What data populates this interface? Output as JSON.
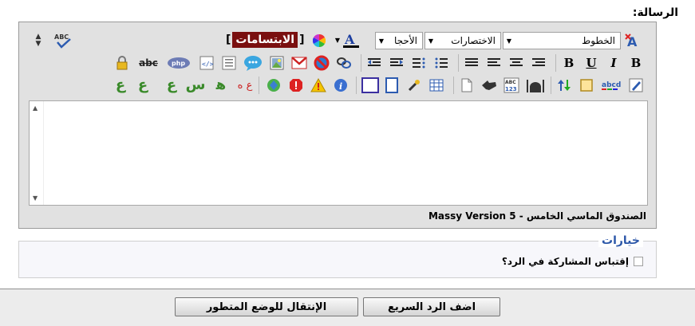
{
  "form": {
    "message_label": "الرسالة:"
  },
  "editor": {
    "font_select": "الخطوط",
    "shortcuts_select": "الاختصارات",
    "size_select": "الأحجا",
    "smilies_open": "[",
    "smilies_label": "الابتسامات",
    "smilies_close": "]",
    "footer_text": "Massy Version 5 - الصندوق الماسي الخامس",
    "row1_icons": [
      "format-wizard-icon",
      "font-color-icon",
      "color-palette-icon",
      "spellcheck-icon",
      "resize-icon"
    ],
    "row2_icons": [
      "bold-icon",
      "italic-icon",
      "underline-icon",
      "bold-alt-icon",
      "align-right-icon",
      "align-center-icon",
      "align-left-icon",
      "justify-icon",
      "ordered-list-icon",
      "unordered-list-icon",
      "indent-icon",
      "outdent-icon",
      "link-icon",
      "remove-link-icon",
      "email-icon",
      "image-icon",
      "speech-bubble-icon",
      "code-icon",
      "html-icon",
      "php-icon",
      "strikethrough-icon",
      "lock-icon"
    ],
    "row3_icons": [
      "edit-icon",
      "word-count-icon",
      "box-icon",
      "sort-icon",
      "mosque-icon",
      "abc123-icon",
      "hand-icon",
      "document-icon",
      "table-icon",
      "tools-icon",
      "page-icon",
      "square-icon",
      "info-icon",
      "warning-icon",
      "stop-icon",
      "globe-icon",
      "arabic-letters-1",
      "arabic-letters-2",
      "arabic-letters-3",
      "arabic-letters-4",
      "arabic-letters-5",
      "arabic-letters-6"
    ],
    "arabic_glyphs": [
      "ع ه",
      "ﻫ",
      "س",
      "ع",
      "ع",
      "ع"
    ],
    "row3_letter_glyph": "ع ه"
  },
  "options": {
    "legend": "خيارات",
    "quote_label": "إقتباس المشاركة في الرد؟",
    "quote_checked": false
  },
  "buttons": {
    "quick_reply": "اضف الرد السريع",
    "advanced_mode": "الإنتقال للوضع المتطور"
  },
  "colors": {
    "toolbar_bg": "#e1e1e1",
    "smilies_bg": "#7a0f0f",
    "legend": "#2b56a8",
    "arabic_glyph": "#3a8a2a"
  }
}
